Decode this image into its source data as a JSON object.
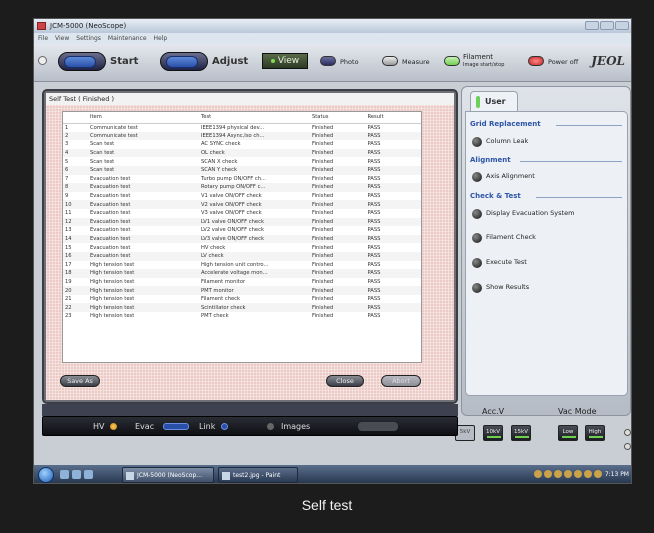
{
  "window": {
    "title": "JCM-5000 (NeoScope)"
  },
  "menu": [
    "File",
    "View",
    "Settings",
    "Maintenance",
    "Help"
  ],
  "toolbar": {
    "start_label": "Start",
    "adjust_label": "Adjust",
    "view_label": "View",
    "photo_label": "Photo",
    "measure_label": "Measure",
    "filament_label": "Filament",
    "filament_sub": "Image start/stop",
    "poweroff_label": "Power off",
    "brand": "JEOL"
  },
  "dialog": {
    "title": "Self Test ( Finished )",
    "columns": [
      "",
      "Item",
      "Test",
      "Status",
      "Result"
    ],
    "rows": [
      [
        "1",
        "Communicate test",
        "IEEE1394 physical dev...",
        "Finished",
        "PASS"
      ],
      [
        "2",
        "Communicate test",
        "IEEE1394 Async,Iso ch...",
        "Finished",
        "PASS"
      ],
      [
        "3",
        "Scan test",
        "AC SYNC check",
        "Finished",
        "PASS"
      ],
      [
        "4",
        "Scan test",
        "OL check",
        "Finished",
        "PASS"
      ],
      [
        "5",
        "Scan test",
        "SCAN X check",
        "Finished",
        "PASS"
      ],
      [
        "6",
        "Scan test",
        "SCAN Y check",
        "Finished",
        "PASS"
      ],
      [
        "7",
        "Evacuation test",
        "Turbo pump ON/OFF ch...",
        "Finished",
        "PASS"
      ],
      [
        "8",
        "Evacuation test",
        "Rotary pump ON/OFF c...",
        "Finished",
        "PASS"
      ],
      [
        "9",
        "Evacuation test",
        "V1 valve ON/OFF check",
        "Finished",
        "PASS"
      ],
      [
        "10",
        "Evacuation test",
        "V2 valve ON/OFF check",
        "Finished",
        "PASS"
      ],
      [
        "11",
        "Evacuation test",
        "V3 valve ON/OFF check",
        "Finished",
        "PASS"
      ],
      [
        "12",
        "Evacuation test",
        "LV1 valve ON/OFF check",
        "Finished",
        "PASS"
      ],
      [
        "13",
        "Evacuation test",
        "LV2 valve ON/OFF check",
        "Finished",
        "PASS"
      ],
      [
        "14",
        "Evacuation test",
        "LV3 valve ON/OFF check",
        "Finished",
        "PASS"
      ],
      [
        "15",
        "Evacuation test",
        "HV check",
        "Finished",
        "PASS"
      ],
      [
        "16",
        "Evacuation test",
        "LV check",
        "Finished",
        "PASS"
      ],
      [
        "17",
        "High tension test",
        "High tension unit contro...",
        "Finished",
        "PASS"
      ],
      [
        "18",
        "High tension test",
        "Accelerate voltage mon...",
        "Finished",
        "PASS"
      ],
      [
        "19",
        "High tension test",
        "Filament monitor",
        "Finished",
        "PASS"
      ],
      [
        "20",
        "High tension test",
        "PMT monitor",
        "Finished",
        "PASS"
      ],
      [
        "21",
        "High tension test",
        "Filament check",
        "Finished",
        "PASS"
      ],
      [
        "22",
        "High tension test",
        "Scintillator check",
        "Finished",
        "PASS"
      ],
      [
        "23",
        "High tension test",
        "PMT check",
        "Finished",
        "PASS"
      ]
    ],
    "save_as": "Save As",
    "close": "Close",
    "abort": "Abort"
  },
  "panel": {
    "tab": "User",
    "sections": [
      {
        "title": "Grid Replacement",
        "items": [
          "Column Leak"
        ]
      },
      {
        "title": "Alignment",
        "items": [
          "Axis Alignment"
        ]
      },
      {
        "title": "Check & Test",
        "items": [
          "Display Evacuation System",
          "Filament Check",
          "Execute Test",
          "Show Results"
        ]
      }
    ],
    "accv_label": "Acc.V",
    "accv_options": [
      "5kV",
      "10kV",
      "15kV"
    ],
    "accv_selected": "10kV",
    "vac_label": "Vac Mode",
    "vac_options": [
      "Low",
      "High"
    ]
  },
  "status": {
    "hv": "HV",
    "evac": "Evac",
    "link": "Link",
    "images": "Images"
  },
  "taskbar": {
    "tasks": [
      "JCM-5000 (NeoScop...",
      "test2.jpg - Paint"
    ],
    "time": "7:13 PM"
  },
  "caption": "Self test",
  "colors": {
    "accent_blue": "#2d56a8",
    "led_green": "#6ed04e",
    "dialog_bg": "#eccbc6"
  }
}
